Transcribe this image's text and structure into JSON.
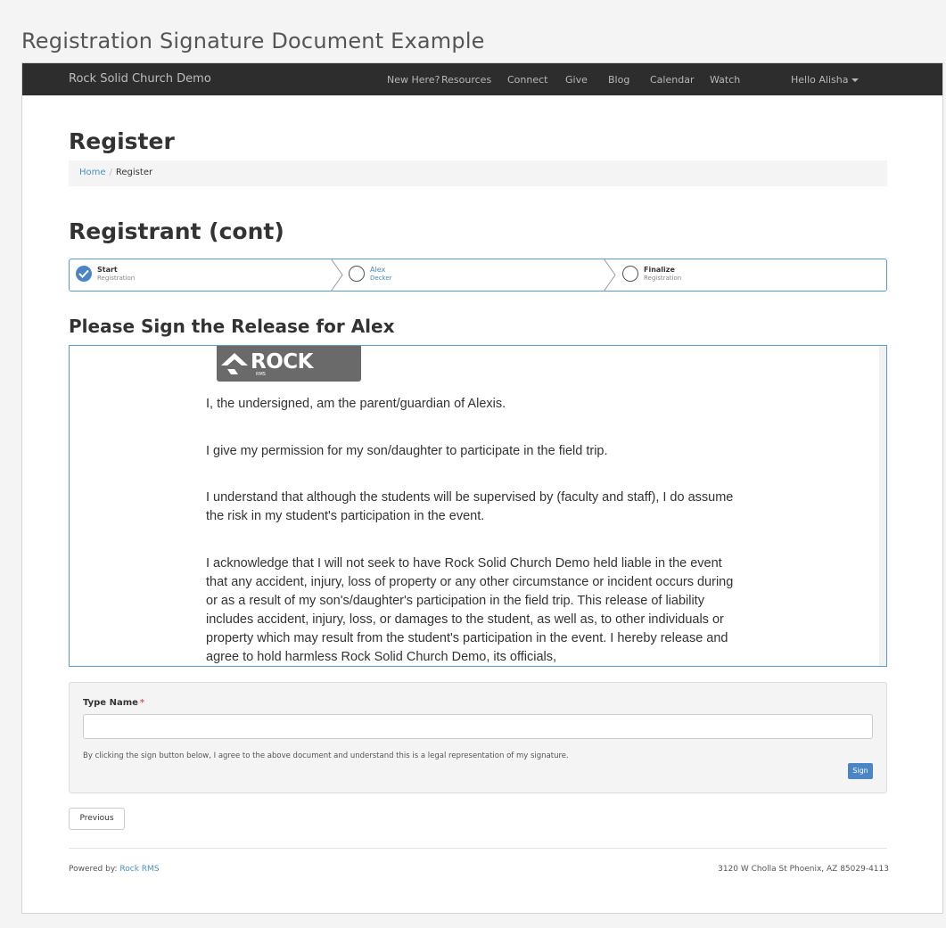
{
  "page_title": "Registration Signature Document Example",
  "navbar": {
    "brand": "Rock Solid Church Demo",
    "links": [
      "New Here?",
      "Resources",
      "Connect",
      "Give",
      "Blog",
      "Calendar",
      "Watch"
    ],
    "user": "Hello Alisha"
  },
  "heading": "Register",
  "breadcrumb": {
    "home": "Home",
    "separator": "/",
    "current": "Register"
  },
  "registrant_heading": "Registrant (cont)",
  "steps": [
    {
      "title": "Start",
      "subtitle": "Registration",
      "state": "complete"
    },
    {
      "title": "Alex",
      "subtitle": "Decker",
      "state": "active"
    },
    {
      "title": "Finalize",
      "subtitle": "Registration",
      "state": "pending"
    }
  ],
  "sign_heading": "Please Sign the Release for Alex",
  "document": {
    "logo_text": "ROCK",
    "logo_subtext": "RMS",
    "paragraphs": [
      "I, the undersigned, am the parent/guardian of Alexis.",
      "I give my permission for my son/daughter to participate in the field trip.",
      "I understand that although the students will be supervised by (faculty and staff), I do assume the risk in my student's participation in the event.",
      "I acknowledge that I will not seek to have Rock Solid Church Demo held liable in the event that any accident, injury, loss of property or any other circumstance or incident occurs during or as a result of my son's/daughter's participation in the field trip. This release of liability includes accident, injury, loss, or damages to the student, as well as, to other individuals or property which may result from the student's participation in the event. I hereby release and agree to hold harmless Rock Solid Church Demo, its officials,"
    ]
  },
  "signature": {
    "label": "Type Name",
    "required_marker": "*",
    "value": "",
    "legal_text": "By clicking the sign button below, I agree to the above document and understand this is a legal representation of my signature.",
    "sign_button": "Sign"
  },
  "previous_button": "Previous",
  "footer": {
    "powered_by_label": "Powered by:",
    "powered_by_link": "Rock RMS",
    "address": "3120 W Cholla St Phoenix, AZ 85029-4113"
  },
  "colors": {
    "accent": "#4a86c5",
    "navbar_bg": "#2d2d2d",
    "required": "#e35d5d"
  }
}
